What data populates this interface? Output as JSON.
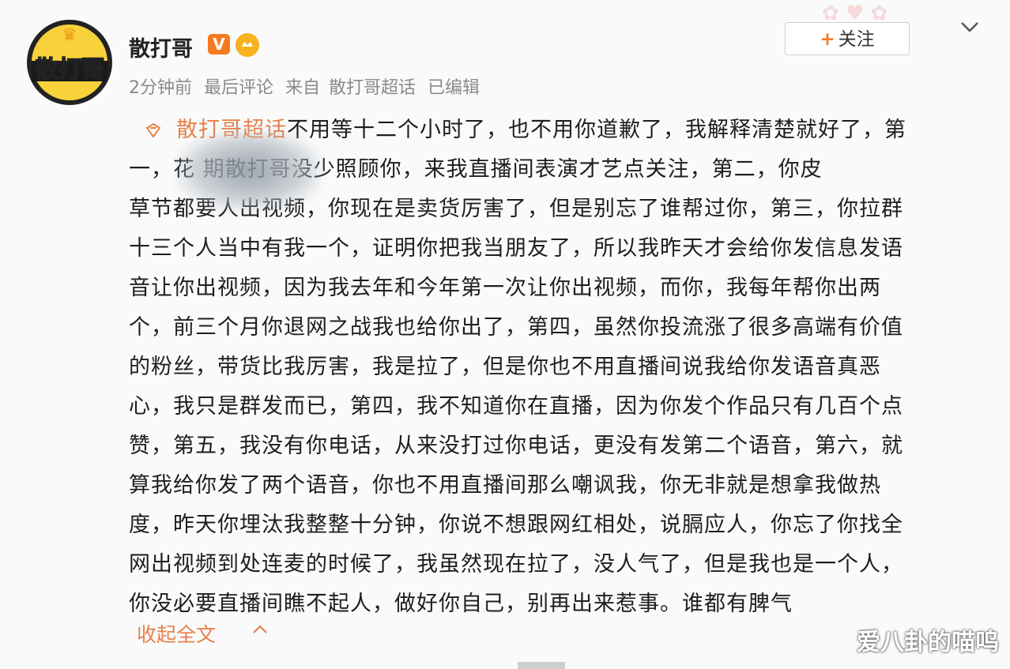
{
  "header": {
    "avatar_text": "散打哥",
    "username": "散打哥",
    "verified_badge": "V",
    "fan_badge_icon": "fan-badge-icon",
    "meta": {
      "time": "2分钟前",
      "last_comment": "最后评论",
      "source_prefix": "来自",
      "source": "散打哥超话",
      "edited": "已编辑"
    },
    "follow_button": {
      "plus": "+",
      "label": "关注"
    },
    "menu_icon": "chevron-down-icon"
  },
  "post": {
    "topic_icon": "supertopic-icon",
    "topic": "散打哥超话",
    "lines": [
      "不用等十二个小时了，也不用你道歉了，我解释清楚就好了，第",
      "一，花          期散打哥没少照顾你，来我直播间表演才艺点关注，第二，你皮",
      "草节都要人出视频，你现在是卖货厉害了，但是别忘了谁帮过你，第三，你拉群",
      "十三个人当中有我一个，证明你把我当朋友了，所以我昨天才会给你发信息发语",
      "音让你出视频，因为我去年和今年第一次让你出视频，而你，我每年帮你出两",
      "个，前三个月你退网之战我也给你出了，第四，虽然你投流涨了很多高端有价值",
      "的粉丝，带货比我厉害，我是拉了，但是你也不用直播间说我给你发语音真恶",
      "心，我只是群发而已，第四，我不知道你在直播，因为你发个作品只有几百个点",
      "赞，第五，我没有你电话，从来没打过你电话，更没有发第二个语音，第六，就",
      "算我给你发了两个语音，你也不用直播间那么嘲讽我，你无非就是想拿我做热",
      "度，昨天你埋汰我整整十分钟，你说不想跟网红相处，说膈应人，你忘了你找全",
      "网出视频到处连麦的时候了，我虽然现在拉了，没人气了，但是我也是一个人，",
      "你没必要直播间瞧不起人，做好你自己，别再出来惹事。谁都有脾气"
    ],
    "collapse_label": "收起全文",
    "collapse_icon": "chevron-up-icon"
  },
  "watermark": "爱八卦的喵呜",
  "colors": {
    "accent": "#e6814a",
    "follow_plus": "#f27b24",
    "verified": "#f47a1f",
    "meta_gray": "#8a8a8a"
  }
}
